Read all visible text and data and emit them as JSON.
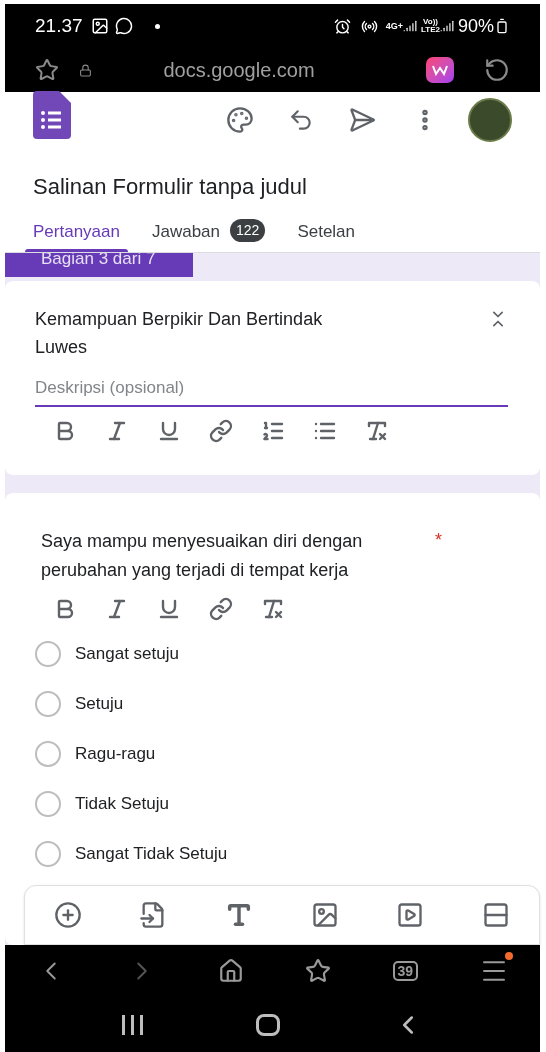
{
  "status_bar": {
    "time": "21.37",
    "network_1": "4G+",
    "network_2": "Vo))\nLTE2",
    "battery": "90%"
  },
  "address_bar": {
    "url": "docs.google.com"
  },
  "form": {
    "title": "Salinan Formulir tanpa judul",
    "tabs": [
      {
        "label": "Pertanyaan",
        "selected": true
      },
      {
        "label": "Jawaban",
        "badge": "122",
        "selected": false
      },
      {
        "label": "Setelan",
        "selected": false
      }
    ],
    "section_tab": "Bagian 3 dari 7",
    "section": {
      "title": "Kemampuan Berpikir Dan Bertindak Luwes",
      "description_placeholder": "Deskripsi (opsional)"
    },
    "question": {
      "text": "Saya mampu menyesuaikan diri dengan perubahan yang terjadi di tempat kerja",
      "required_mark": "*",
      "options": [
        {
          "label": "Sangat setuju",
          "selected": false
        },
        {
          "label": "Setuju",
          "selected": false
        },
        {
          "label": "Ragu-ragu",
          "selected": false
        },
        {
          "label": "Tidak Setuju",
          "selected": false
        },
        {
          "label": "Sangat Tidak Setuju",
          "selected": false
        }
      ]
    }
  },
  "browser_nav": {
    "tab_count": "39",
    "menu_notification": true
  }
}
